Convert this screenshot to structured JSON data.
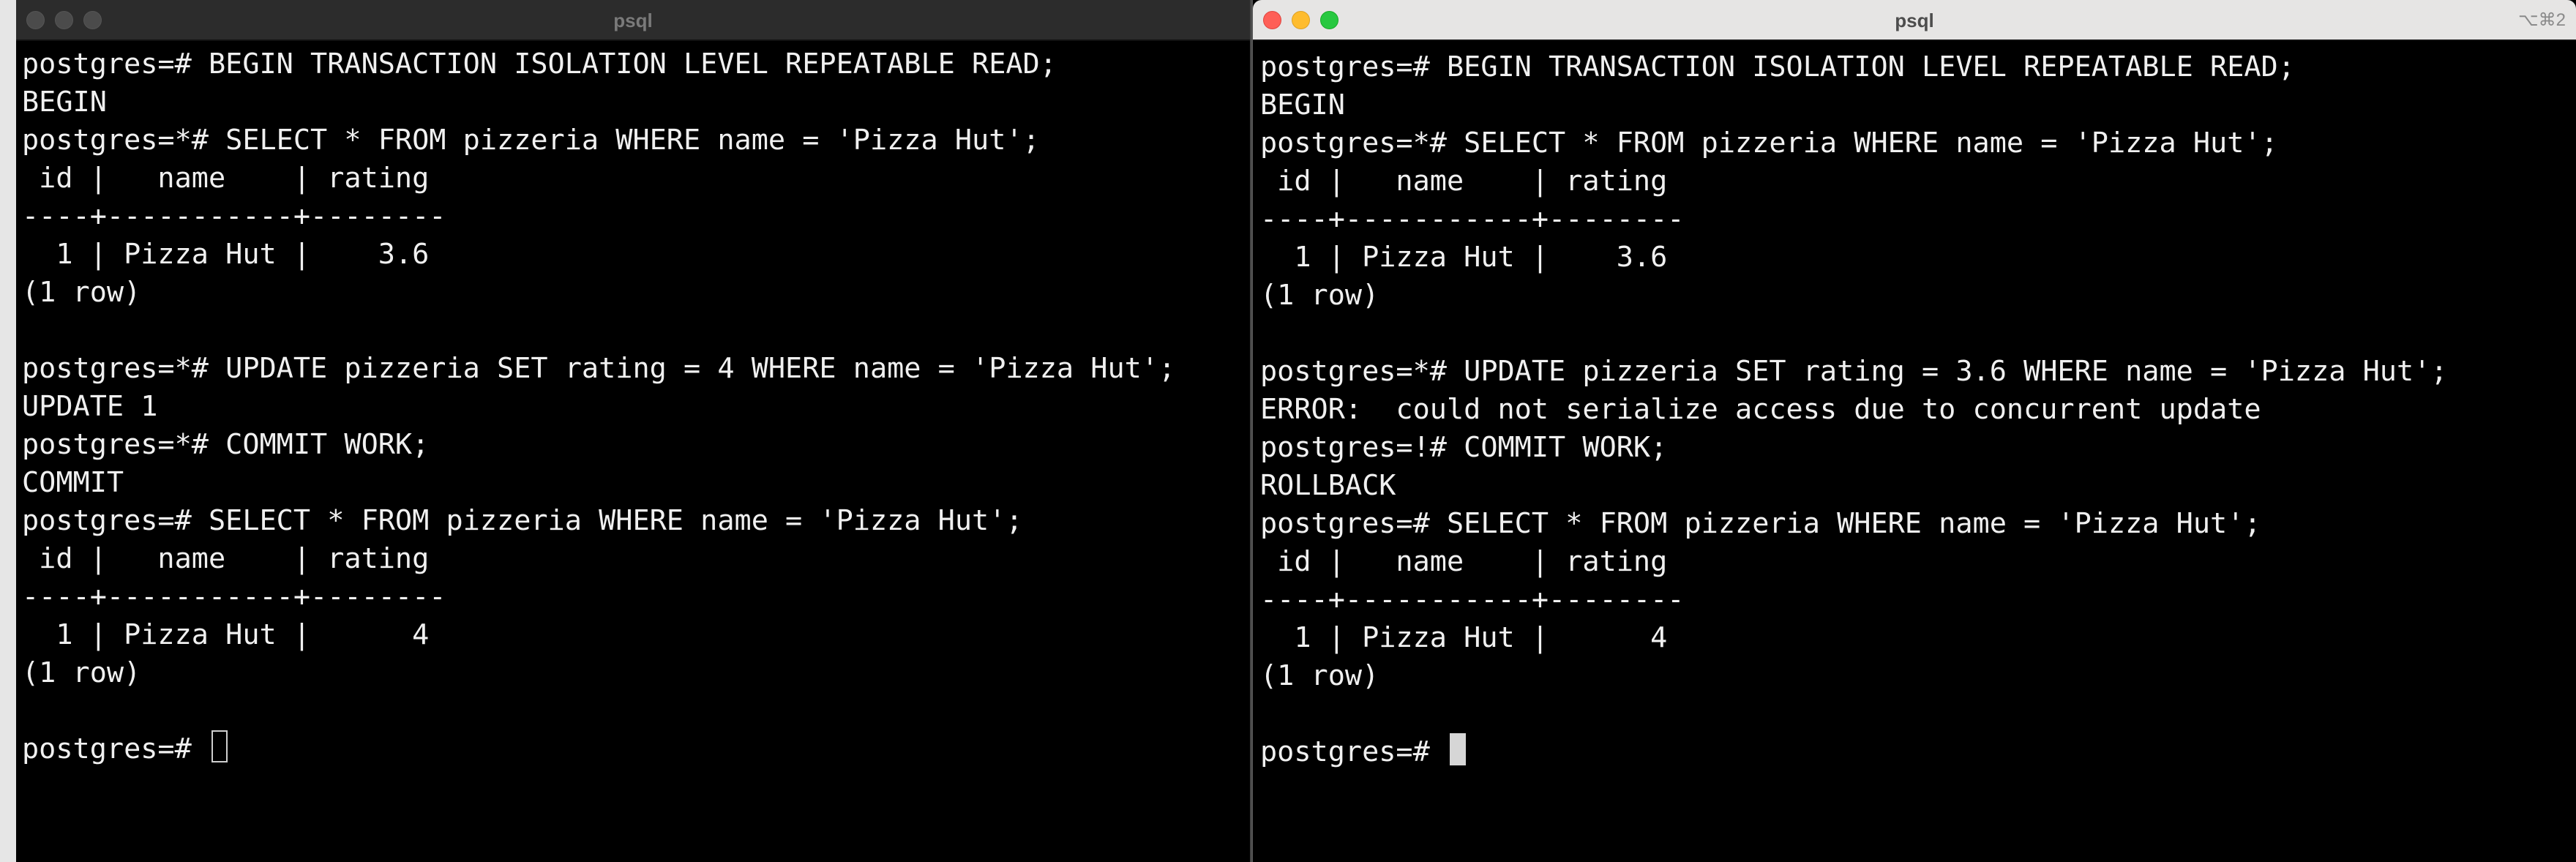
{
  "left_window": {
    "title": "psql",
    "lines": [
      "postgres=# BEGIN TRANSACTION ISOLATION LEVEL REPEATABLE READ;",
      "BEGIN",
      "postgres=*# SELECT * FROM pizzeria WHERE name = 'Pizza Hut';",
      " id |   name    | rating",
      "----+-----------+--------",
      "  1 | Pizza Hut |    3.6",
      "(1 row)",
      "",
      "postgres=*# UPDATE pizzeria SET rating = 4 WHERE name = 'Pizza Hut';",
      "UPDATE 1",
      "postgres=*# COMMIT WORK;",
      "COMMIT",
      "postgres=# SELECT * FROM pizzeria WHERE name = 'Pizza Hut';",
      " id |   name    | rating",
      "----+-----------+--------",
      "  1 | Pizza Hut |      4",
      "(1 row)",
      ""
    ],
    "prompt": "postgres=# "
  },
  "right_window": {
    "title": "psql",
    "shortcut": "⌥⌘2",
    "lines": [
      "postgres=# BEGIN TRANSACTION ISOLATION LEVEL REPEATABLE READ;",
      "BEGIN",
      "postgres=*# SELECT * FROM pizzeria WHERE name = 'Pizza Hut';",
      " id |   name    | rating",
      "----+-----------+--------",
      "  1 | Pizza Hut |    3.6",
      "(1 row)",
      "",
      "postgres=*# UPDATE pizzeria SET rating = 3.6 WHERE name = 'Pizza Hut';",
      "ERROR:  could not serialize access due to concurrent update",
      "postgres=!# COMMIT WORK;",
      "ROLLBACK",
      "postgres=# SELECT * FROM pizzeria WHERE name = 'Pizza Hut';",
      " id |   name    | rating",
      "----+-----------+--------",
      "  1 | Pizza Hut |      4",
      "(1 row)",
      ""
    ],
    "prompt": "postgres=# "
  },
  "icons": {
    "left_close": "close-icon",
    "left_minimize": "minimize-icon",
    "left_zoom": "zoom-icon",
    "right_close": "close-icon",
    "right_minimize": "minimize-icon",
    "right_zoom": "zoom-icon"
  },
  "colors": {
    "terminal_bg": "#000000",
    "terminal_fg": "#f0f0f0",
    "close": "#fe5f57",
    "minimize": "#febc2e",
    "zoom": "#28c840"
  }
}
